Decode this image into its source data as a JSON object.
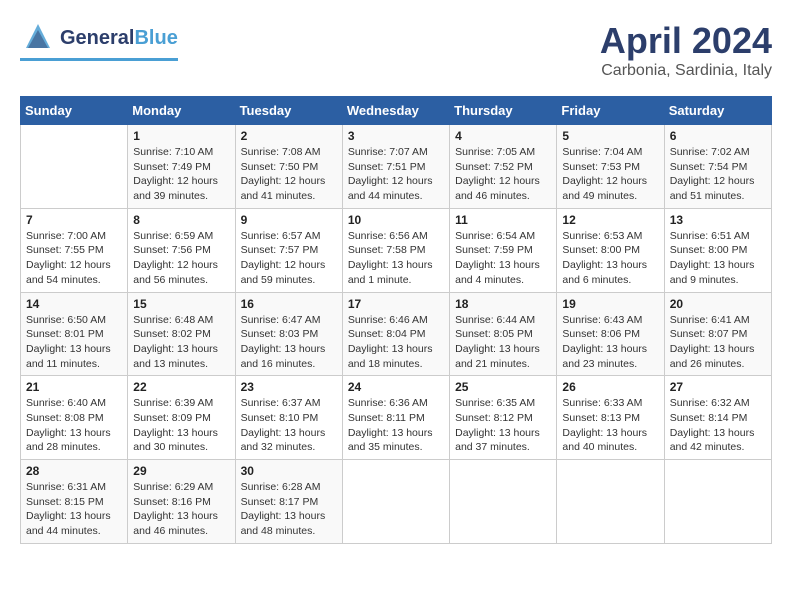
{
  "logo": {
    "line1": "General",
    "line2": "Blue"
  },
  "title": "April 2024",
  "location": "Carbonia, Sardinia, Italy",
  "days_of_week": [
    "Sunday",
    "Monday",
    "Tuesday",
    "Wednesday",
    "Thursday",
    "Friday",
    "Saturday"
  ],
  "weeks": [
    [
      {
        "day": "",
        "info": ""
      },
      {
        "day": "1",
        "info": "Sunrise: 7:10 AM\nSunset: 7:49 PM\nDaylight: 12 hours\nand 39 minutes."
      },
      {
        "day": "2",
        "info": "Sunrise: 7:08 AM\nSunset: 7:50 PM\nDaylight: 12 hours\nand 41 minutes."
      },
      {
        "day": "3",
        "info": "Sunrise: 7:07 AM\nSunset: 7:51 PM\nDaylight: 12 hours\nand 44 minutes."
      },
      {
        "day": "4",
        "info": "Sunrise: 7:05 AM\nSunset: 7:52 PM\nDaylight: 12 hours\nand 46 minutes."
      },
      {
        "day": "5",
        "info": "Sunrise: 7:04 AM\nSunset: 7:53 PM\nDaylight: 12 hours\nand 49 minutes."
      },
      {
        "day": "6",
        "info": "Sunrise: 7:02 AM\nSunset: 7:54 PM\nDaylight: 12 hours\nand 51 minutes."
      }
    ],
    [
      {
        "day": "7",
        "info": "Sunrise: 7:00 AM\nSunset: 7:55 PM\nDaylight: 12 hours\nand 54 minutes."
      },
      {
        "day": "8",
        "info": "Sunrise: 6:59 AM\nSunset: 7:56 PM\nDaylight: 12 hours\nand 56 minutes."
      },
      {
        "day": "9",
        "info": "Sunrise: 6:57 AM\nSunset: 7:57 PM\nDaylight: 12 hours\nand 59 minutes."
      },
      {
        "day": "10",
        "info": "Sunrise: 6:56 AM\nSunset: 7:58 PM\nDaylight: 13 hours\nand 1 minute."
      },
      {
        "day": "11",
        "info": "Sunrise: 6:54 AM\nSunset: 7:59 PM\nDaylight: 13 hours\nand 4 minutes."
      },
      {
        "day": "12",
        "info": "Sunrise: 6:53 AM\nSunset: 8:00 PM\nDaylight: 13 hours\nand 6 minutes."
      },
      {
        "day": "13",
        "info": "Sunrise: 6:51 AM\nSunset: 8:00 PM\nDaylight: 13 hours\nand 9 minutes."
      }
    ],
    [
      {
        "day": "14",
        "info": "Sunrise: 6:50 AM\nSunset: 8:01 PM\nDaylight: 13 hours\nand 11 minutes."
      },
      {
        "day": "15",
        "info": "Sunrise: 6:48 AM\nSunset: 8:02 PM\nDaylight: 13 hours\nand 13 minutes."
      },
      {
        "day": "16",
        "info": "Sunrise: 6:47 AM\nSunset: 8:03 PM\nDaylight: 13 hours\nand 16 minutes."
      },
      {
        "day": "17",
        "info": "Sunrise: 6:46 AM\nSunset: 8:04 PM\nDaylight: 13 hours\nand 18 minutes."
      },
      {
        "day": "18",
        "info": "Sunrise: 6:44 AM\nSunset: 8:05 PM\nDaylight: 13 hours\nand 21 minutes."
      },
      {
        "day": "19",
        "info": "Sunrise: 6:43 AM\nSunset: 8:06 PM\nDaylight: 13 hours\nand 23 minutes."
      },
      {
        "day": "20",
        "info": "Sunrise: 6:41 AM\nSunset: 8:07 PM\nDaylight: 13 hours\nand 26 minutes."
      }
    ],
    [
      {
        "day": "21",
        "info": "Sunrise: 6:40 AM\nSunset: 8:08 PM\nDaylight: 13 hours\nand 28 minutes."
      },
      {
        "day": "22",
        "info": "Sunrise: 6:39 AM\nSunset: 8:09 PM\nDaylight: 13 hours\nand 30 minutes."
      },
      {
        "day": "23",
        "info": "Sunrise: 6:37 AM\nSunset: 8:10 PM\nDaylight: 13 hours\nand 32 minutes."
      },
      {
        "day": "24",
        "info": "Sunrise: 6:36 AM\nSunset: 8:11 PM\nDaylight: 13 hours\nand 35 minutes."
      },
      {
        "day": "25",
        "info": "Sunrise: 6:35 AM\nSunset: 8:12 PM\nDaylight: 13 hours\nand 37 minutes."
      },
      {
        "day": "26",
        "info": "Sunrise: 6:33 AM\nSunset: 8:13 PM\nDaylight: 13 hours\nand 40 minutes."
      },
      {
        "day": "27",
        "info": "Sunrise: 6:32 AM\nSunset: 8:14 PM\nDaylight: 13 hours\nand 42 minutes."
      }
    ],
    [
      {
        "day": "28",
        "info": "Sunrise: 6:31 AM\nSunset: 8:15 PM\nDaylight: 13 hours\nand 44 minutes."
      },
      {
        "day": "29",
        "info": "Sunrise: 6:29 AM\nSunset: 8:16 PM\nDaylight: 13 hours\nand 46 minutes."
      },
      {
        "day": "30",
        "info": "Sunrise: 6:28 AM\nSunset: 8:17 PM\nDaylight: 13 hours\nand 48 minutes."
      },
      {
        "day": "",
        "info": ""
      },
      {
        "day": "",
        "info": ""
      },
      {
        "day": "",
        "info": ""
      },
      {
        "day": "",
        "info": ""
      }
    ]
  ]
}
